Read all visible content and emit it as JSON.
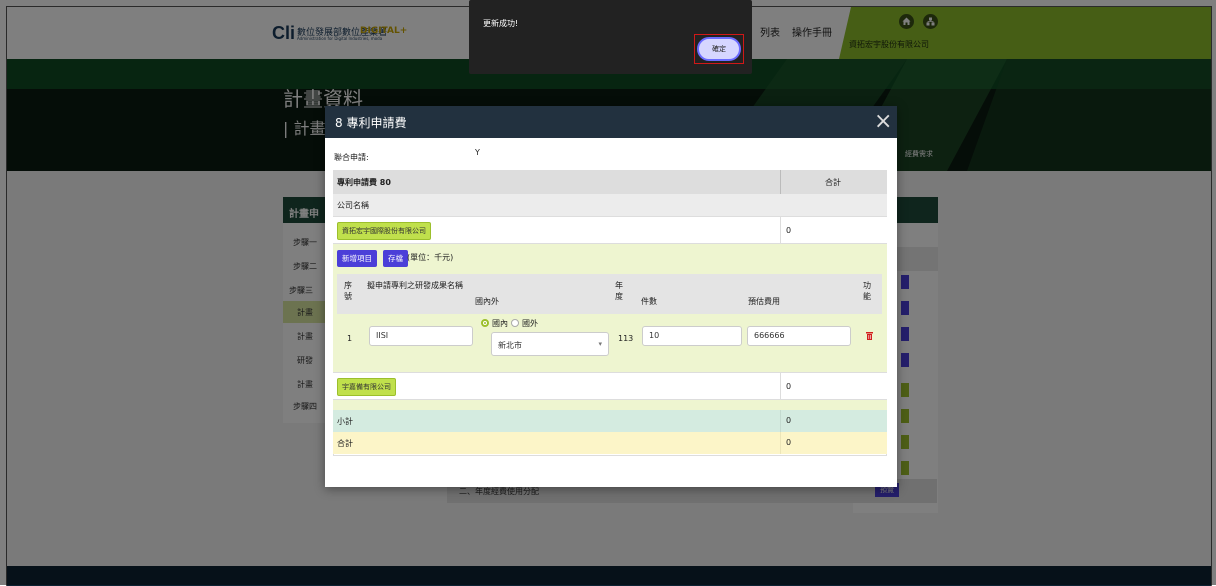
{
  "header": {
    "logo_mark": "Cli",
    "logo_cn": "數位發展部數位產業署",
    "logo_en": "Administration for Digital Industries, moda",
    "logo_digital": "DIGITAL+",
    "nav": [
      "列表",
      "操作手冊"
    ],
    "company": "資拓宏宇股份有限公司"
  },
  "banner": {
    "title": "計畫資料",
    "subtitle": "計畫",
    "right_text": "經費需求"
  },
  "sidebar": {
    "title": "計畫申",
    "steps": [
      "步驟一",
      "步驟二",
      "步驟三",
      "計畫",
      "計畫",
      "研發",
      "計畫",
      "步驟四"
    ]
  },
  "page": {
    "bottom_row": "二、年度經費使用分配",
    "bottom_button": "預覽"
  },
  "toast": {
    "message": "更新成功!",
    "ok_label": "確定"
  },
  "modal": {
    "title": "8 專利申請費",
    "joint_label": "聯合申請:",
    "joint_value": "Y",
    "header_left": "專利申請費 80",
    "header_total": "合計",
    "company_col": "公司名稱",
    "company1": {
      "name": "資拓宏宇國際股份有限公司",
      "total": "0",
      "add_button": "新增項目",
      "save_button": "存檔",
      "unit": "(單位：千元)",
      "columns": {
        "seq": "序號",
        "name": "擬申請專利之研發成果名稱",
        "domestic": "國內外",
        "year": "年度",
        "count": "件數",
        "cost": "預估費用",
        "func": "功能"
      },
      "row": {
        "seq": "1",
        "name": "IISI",
        "radio_domestic": "國內",
        "radio_foreign": "國外",
        "city": "新北市",
        "year": "113",
        "count": "10",
        "cost": "666666"
      }
    },
    "company2": {
      "name": "宇嘉備有限公司",
      "total": "0"
    },
    "subtotal_label": "小計",
    "subtotal_value": "0",
    "total_label": "合計",
    "total_value": "0"
  }
}
